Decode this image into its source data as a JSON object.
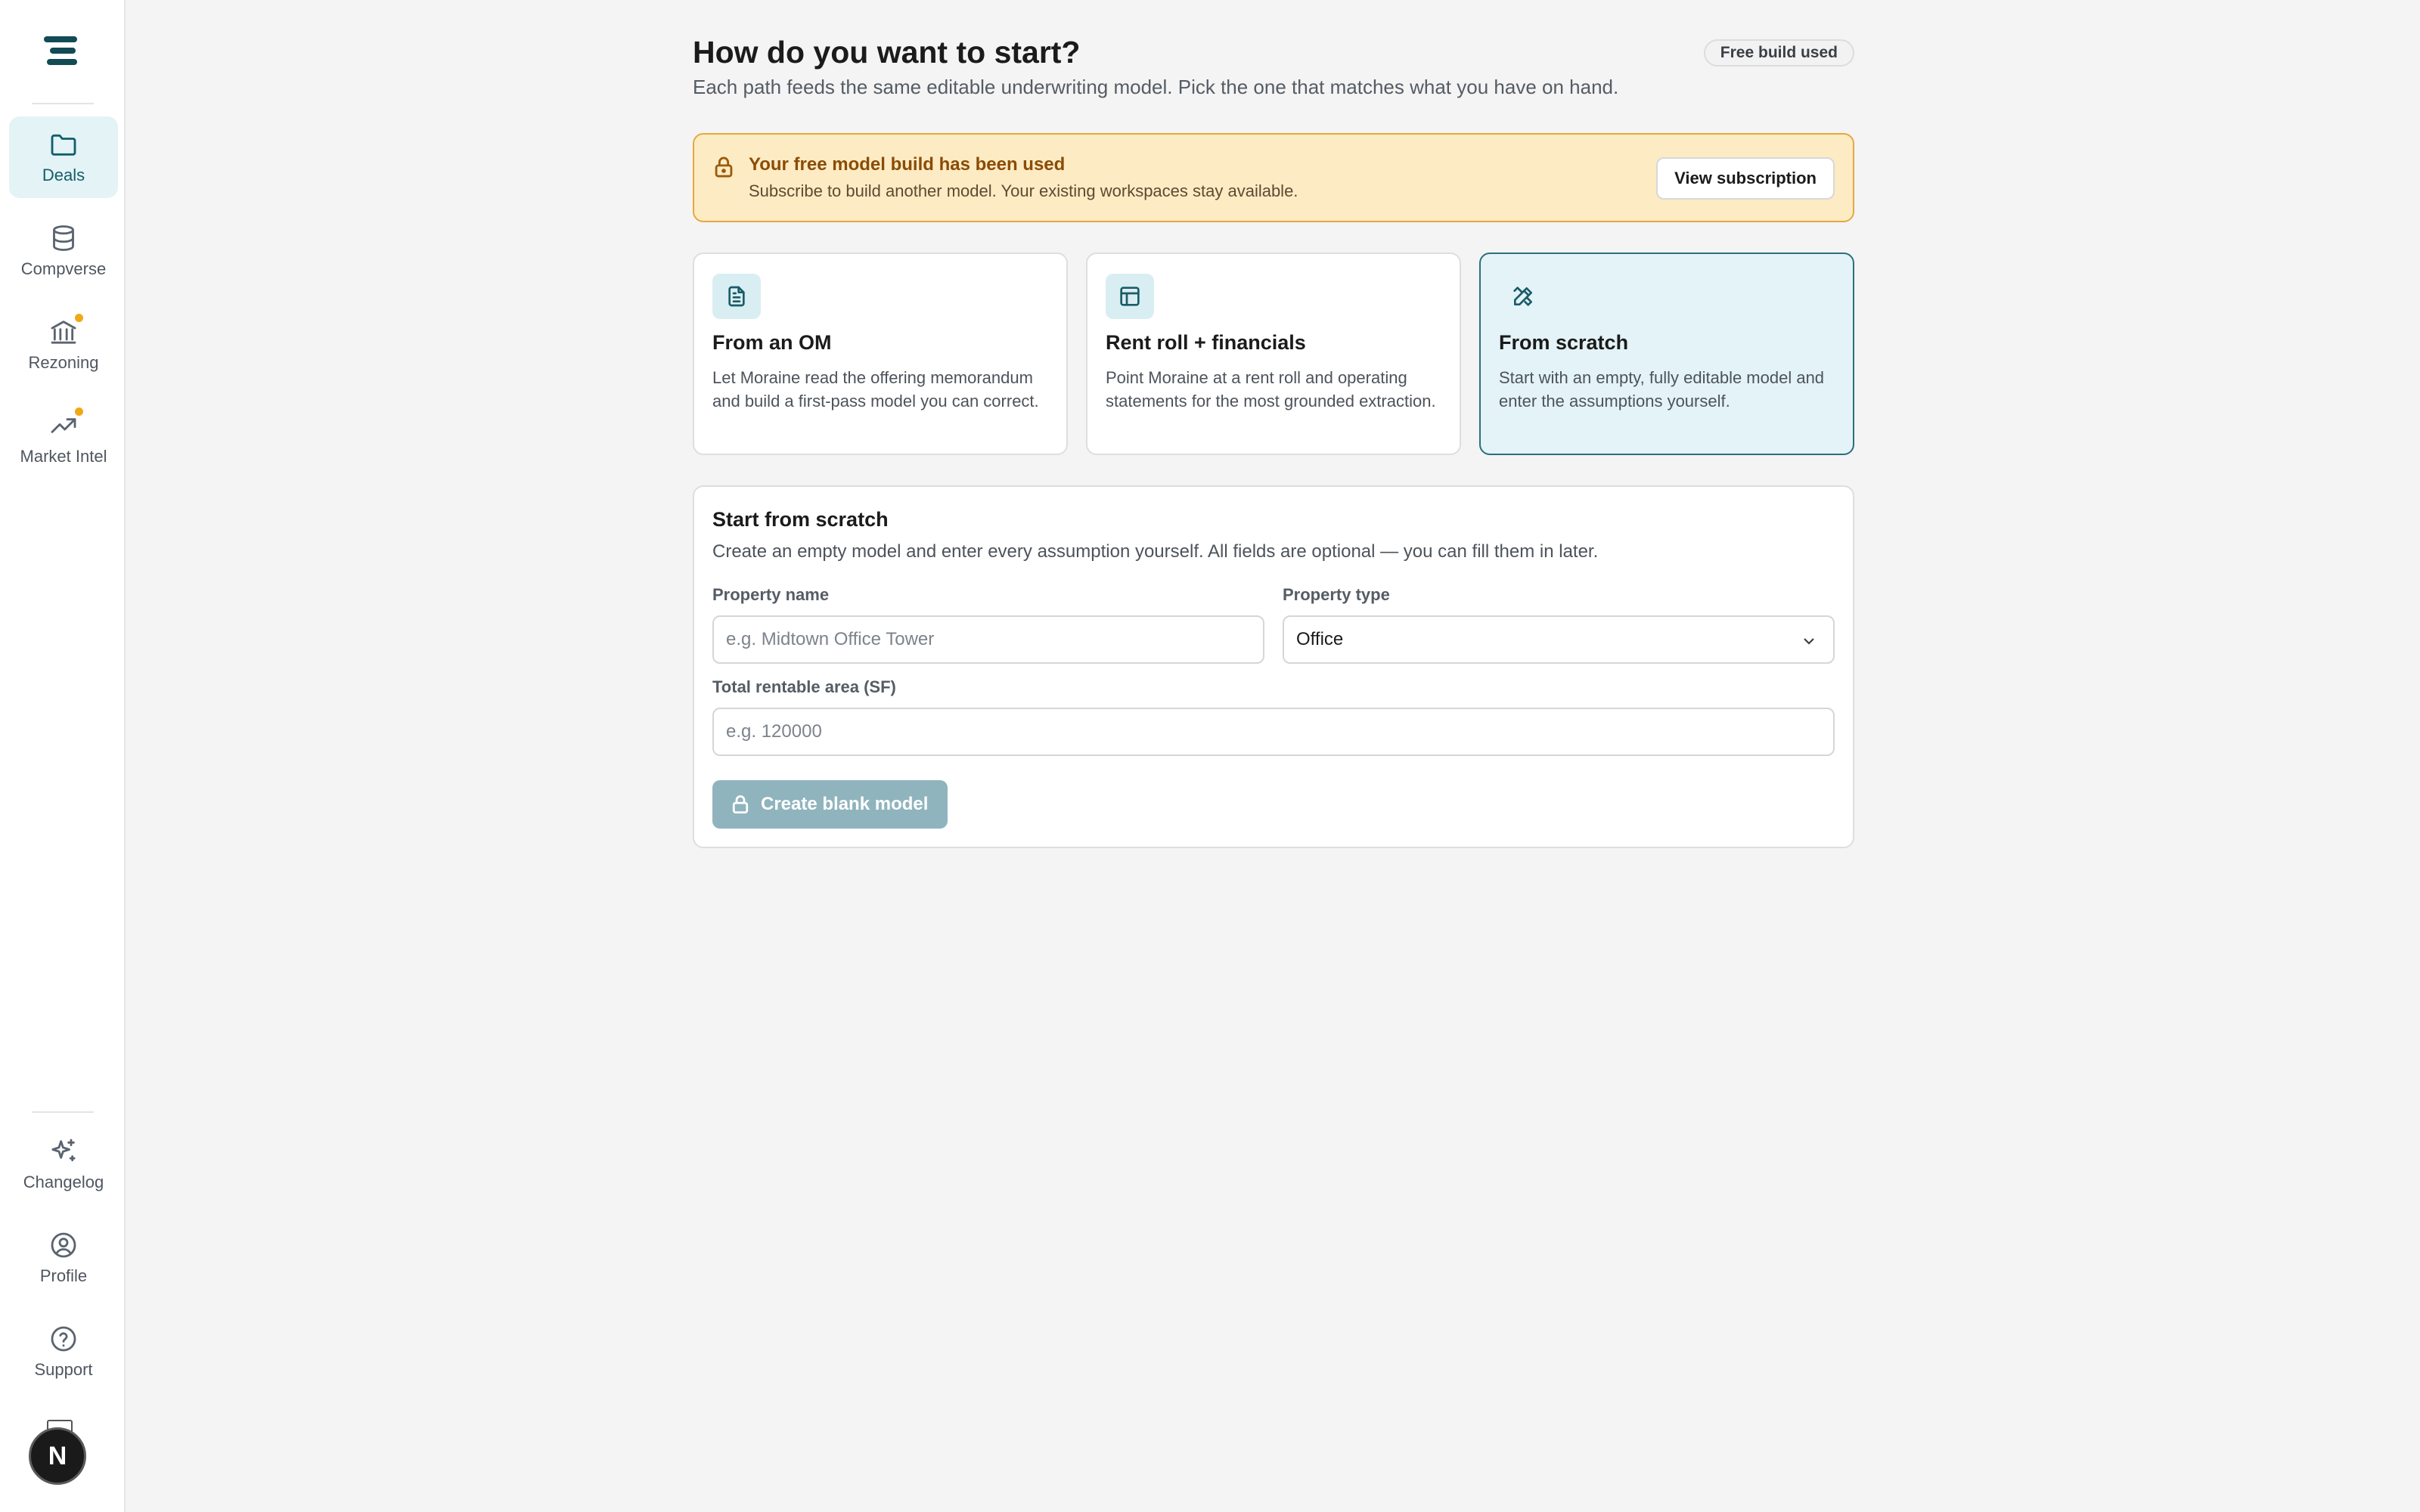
{
  "sidebar": {
    "top_items": [
      {
        "label": "Deals",
        "icon": "folder-icon",
        "active": true
      },
      {
        "label": "Compverse",
        "icon": "database-icon"
      },
      {
        "label": "Rezoning",
        "icon": "bank-icon",
        "indicator": true
      },
      {
        "label": "Market Intel",
        "icon": "trend-up-icon",
        "indicator": true
      }
    ],
    "bottom_items": [
      {
        "label": "Changelog",
        "icon": "sparkles-icon"
      },
      {
        "label": "Profile",
        "icon": "user-circle-icon"
      },
      {
        "label": "Support",
        "icon": "help-circle-icon"
      }
    ],
    "avatar_initial": "N"
  },
  "header": {
    "title": "How do you want to start?",
    "subtitle": "Each path feeds the same editable underwriting model. Pick the one that matches what you have on hand.",
    "badge": "Free build used"
  },
  "alert": {
    "title": "Your free model build has been used",
    "text": "Subscribe to build another model. Your existing workspaces stay available.",
    "button": "View subscription"
  },
  "cards": [
    {
      "title": "From an OM",
      "desc": "Let Moraine read the offering memorandum and build a first-pass model you can correct.",
      "icon": "document-icon"
    },
    {
      "title": "Rent roll + financials",
      "desc": "Point Moraine at a rent roll and operating statements for the most grounded extraction.",
      "icon": "table-icon"
    },
    {
      "title": "From scratch",
      "desc": "Start with an empty, fully editable model and enter the assumptions yourself.",
      "icon": "pencil-ruler-icon",
      "selected": true
    }
  ],
  "form": {
    "title": "Start from scratch",
    "subtitle": "Create an empty model and enter every assumption yourself. All fields are optional — you can fill them in later.",
    "property_name_label": "Property name",
    "property_name_placeholder": "e.g. Midtown Office Tower",
    "property_type_label": "Property type",
    "property_type_value": "Office",
    "area_label": "Total rentable area (SF)",
    "area_placeholder": "e.g. 120000",
    "submit_label": "Create blank model"
  },
  "colors": {
    "accent": "#155d6a",
    "alert_bg": "#fdebc4",
    "alert_border": "#e6a93e",
    "indicator": "#f0a916",
    "disabled_button": "#8fb4be"
  }
}
